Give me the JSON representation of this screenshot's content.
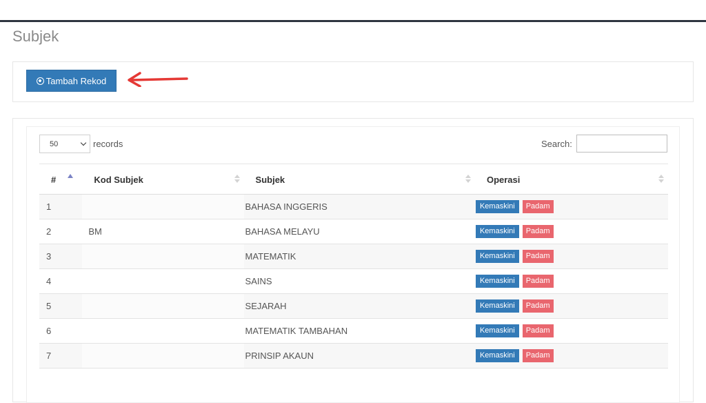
{
  "page": {
    "title": "Subjek"
  },
  "toolbar": {
    "add_label": "Tambah Rekod"
  },
  "length": {
    "value": "50",
    "label": "records"
  },
  "search": {
    "label": "Search:",
    "value": ""
  },
  "table": {
    "headers": [
      "#",
      "Kod Subjek",
      "Subjek",
      "Operasi"
    ],
    "rows": [
      {
        "num": "1",
        "kod": "",
        "subjek": "BAHASA INGGERIS"
      },
      {
        "num": "2",
        "kod": "BM",
        "subjek": "BAHASA MELAYU"
      },
      {
        "num": "3",
        "kod": "",
        "subjek": "MATEMATIK"
      },
      {
        "num": "4",
        "kod": "",
        "subjek": "SAINS"
      },
      {
        "num": "5",
        "kod": "",
        "subjek": "SEJARAH"
      },
      {
        "num": "6",
        "kod": "",
        "subjek": "MATEMATIK TAMBAHAN"
      },
      {
        "num": "7",
        "kod": "",
        "subjek": "PRINSIP AKAUN"
      }
    ],
    "edit_label": "Kemaskini",
    "delete_label": "Padam"
  },
  "colors": {
    "primary": "#337ab7",
    "danger": "#e9666e",
    "arrow": "#e53935",
    "topbar_border": "#2f3540"
  },
  "icons": {
    "add": "plus-circle-icon",
    "annotation": "red-arrow-icon"
  }
}
